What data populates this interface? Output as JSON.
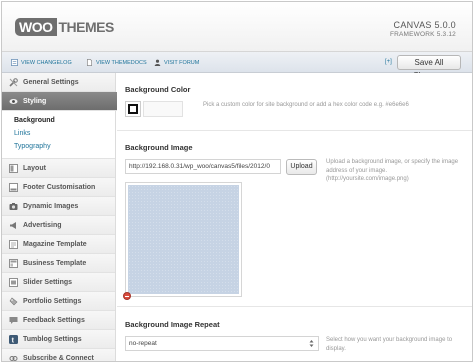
{
  "header": {
    "logo_woo": "WOO",
    "logo_themes": "THEMES",
    "product_name": "CANVAS 5.0.0",
    "framework": "FRAMEWORK 5.3.12"
  },
  "infobar": {
    "links": [
      {
        "label": "VIEW CHANGELOG",
        "icon": "changelog-icon"
      },
      {
        "label": "VIEW THEMEDOCS",
        "icon": "document-icon"
      },
      {
        "label": "VISIT FORUM",
        "icon": "user-icon"
      }
    ],
    "expand_label": "[+]",
    "save_label": "Save All Changes"
  },
  "sidebar": {
    "items": [
      {
        "label": "General Settings",
        "icon": "tools-icon"
      },
      {
        "label": "Styling",
        "icon": "eye-icon",
        "active": true
      },
      {
        "label": "Layout",
        "icon": "layout-icon"
      },
      {
        "label": "Footer Customisation",
        "icon": "footer-icon"
      },
      {
        "label": "Dynamic Images",
        "icon": "camera-icon"
      },
      {
        "label": "Advertising",
        "icon": "megaphone-icon"
      },
      {
        "label": "Magazine Template",
        "icon": "magazine-icon"
      },
      {
        "label": "Business Template",
        "icon": "business-icon"
      },
      {
        "label": "Slider Settings",
        "icon": "slider-icon"
      },
      {
        "label": "Portfolio Settings",
        "icon": "portfolio-icon"
      },
      {
        "label": "Feedback Settings",
        "icon": "feedback-icon"
      },
      {
        "label": "Tumblog Settings",
        "icon": "tumblog-icon"
      },
      {
        "label": "Subscribe & Connect",
        "icon": "connect-icon"
      }
    ],
    "subitems": [
      {
        "label": "Background",
        "current": true
      },
      {
        "label": "Links"
      },
      {
        "label": "Typography"
      }
    ]
  },
  "main": {
    "bg_color": {
      "title": "Background Color",
      "value": "",
      "description": "Pick a custom color for site background or add a hex color code e.g. #e6e6e6"
    },
    "bg_image": {
      "title": "Background Image",
      "url": "http://192.168.0.31/wp_woo/canvas5/files/2012/0",
      "upload_label": "Upload",
      "description": "Upload a background image, or specify the image address of your image. (http://yoursite.com/image.png)"
    },
    "bg_repeat": {
      "title": "Background Image Repeat",
      "selected": "no-repeat",
      "description": "Select how you want your background image to display."
    }
  },
  "colors": {
    "link": "#21759b",
    "active_nav": "#767676",
    "preview_fill": "#c6d3e4"
  }
}
